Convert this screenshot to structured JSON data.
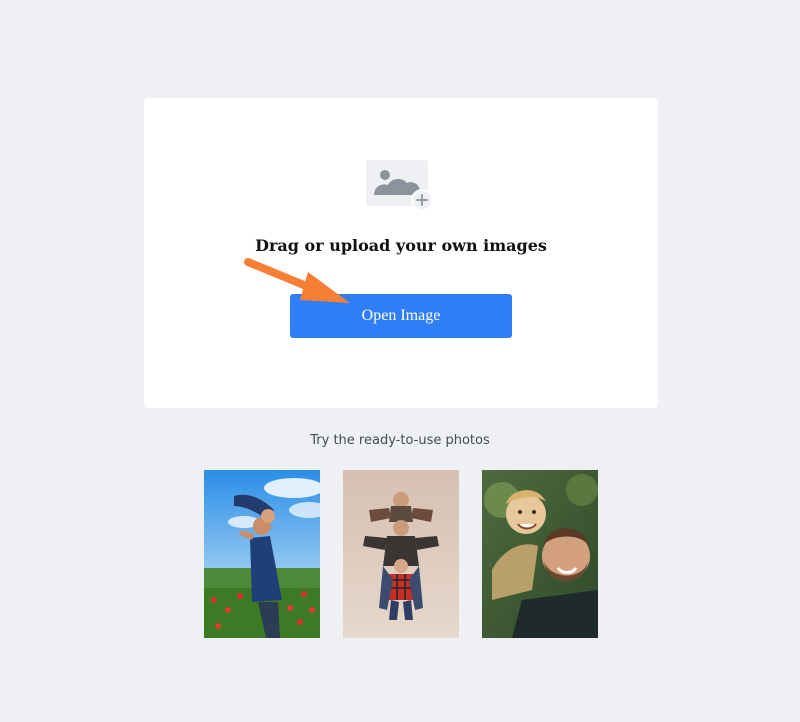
{
  "upload": {
    "icon": "image-add-icon",
    "title": "Drag or upload your own images",
    "button_label": "Open Image"
  },
  "annotation": {
    "icon": "arrow-icon",
    "color": "#f58035"
  },
  "samples": {
    "heading": "Try the ready-to-use photos",
    "photos": [
      {
        "subject": "father lifting child in poppy field"
      },
      {
        "subject": "father and two kids posing in plaid shirts"
      },
      {
        "subject": "smiling man carrying laughing boy on shoulders"
      }
    ]
  },
  "colors": {
    "background": "#eef0f3",
    "card": "#ffffff",
    "button": "#2f7ef6",
    "arrow": "#f58035"
  }
}
